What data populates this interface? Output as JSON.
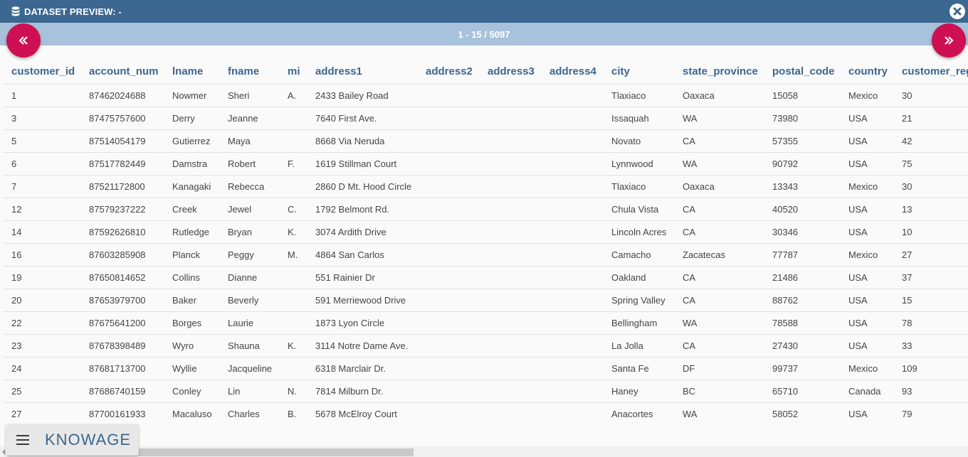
{
  "window": {
    "title": "DATASET PREVIEW: -",
    "icon": "database-icon",
    "close_icon": "close-circle-icon"
  },
  "pager": {
    "range": "1 - 15 / 5097",
    "prev_icon": "double-chevron-left-icon",
    "next_icon": "double-chevron-right-icon"
  },
  "table": {
    "columns": [
      "customer_id",
      "account_num",
      "lname",
      "fname",
      "mi",
      "address1",
      "address2",
      "address3",
      "address4",
      "city",
      "state_province",
      "postal_code",
      "country",
      "customer_region_id"
    ],
    "rows": [
      [
        "1",
        "87462024688",
        "Nowmer",
        "Sheri",
        "A.",
        "2433 Bailey Road",
        "",
        "",
        "",
        "Tlaxiaco",
        "Oaxaca",
        "15058",
        "Mexico",
        "30"
      ],
      [
        "3",
        "87475757600",
        "Derry",
        "Jeanne",
        "",
        "7640 First Ave.",
        "",
        "",
        "",
        "Issaquah",
        "WA",
        "73980",
        "USA",
        "21"
      ],
      [
        "5",
        "87514054179",
        "Gutierrez",
        "Maya",
        "",
        "8668 Via Neruda",
        "",
        "",
        "",
        "Novato",
        "CA",
        "57355",
        "USA",
        "42"
      ],
      [
        "6",
        "87517782449",
        "Damstra",
        "Robert",
        "F.",
        "1619 Stillman Court",
        "",
        "",
        "",
        "Lynnwood",
        "WA",
        "90792",
        "USA",
        "75"
      ],
      [
        "7",
        "87521172800",
        "Kanagaki",
        "Rebecca",
        "",
        "2860 D Mt. Hood Circle",
        "",
        "",
        "",
        "Tlaxiaco",
        "Oaxaca",
        "13343",
        "Mexico",
        "30"
      ],
      [
        "12",
        "87579237222",
        "Creek",
        "Jewel",
        "C.",
        "1792 Belmont Rd.",
        "",
        "",
        "",
        "Chula Vista",
        "CA",
        "40520",
        "USA",
        "13"
      ],
      [
        "14",
        "87592626810",
        "Rutledge",
        "Bryan",
        "K.",
        "3074 Ardith Drive",
        "",
        "",
        "",
        "Lincoln Acres",
        "CA",
        "30346",
        "USA",
        "10"
      ],
      [
        "16",
        "87603285908",
        "Planck",
        "Peggy",
        "M.",
        "4864 San Carlos",
        "",
        "",
        "",
        "Camacho",
        "Zacatecas",
        "77787",
        "Mexico",
        "27"
      ],
      [
        "19",
        "87650814652",
        "Collins",
        "Dianne",
        "",
        "551 Rainier Dr",
        "",
        "",
        "",
        "Oakland",
        "CA",
        "21486",
        "USA",
        "37"
      ],
      [
        "20",
        "87653979700",
        "Baker",
        "Beverly",
        "",
        "591 Merriewood Drive",
        "",
        "",
        "",
        "Spring Valley",
        "CA",
        "88762",
        "USA",
        "15"
      ],
      [
        "22",
        "87675641200",
        "Borges",
        "Laurie",
        "",
        "1873 Lyon Circle",
        "",
        "",
        "",
        "Bellingham",
        "WA",
        "78588",
        "USA",
        "78"
      ],
      [
        "23",
        "87678398489",
        "Wyro",
        "Shauna",
        "K.",
        "3114 Notre Dame Ave.",
        "",
        "",
        "",
        "La Jolla",
        "CA",
        "27430",
        "USA",
        "33"
      ],
      [
        "24",
        "87681713700",
        "Wyllie",
        "Jacqueline",
        "",
        "6318 Marclair Dr.",
        "",
        "",
        "",
        "Santa Fe",
        "DF",
        "99737",
        "Mexico",
        "109"
      ],
      [
        "25",
        "87686740159",
        "Conley",
        "Lin",
        "N.",
        "7814 Milburn Dr.",
        "",
        "",
        "",
        "Haney",
        "BC",
        "65710",
        "Canada",
        "93"
      ],
      [
        "27",
        "87700161933",
        "Macaluso",
        "Charles",
        "B.",
        "5678 McElroy Court",
        "",
        "",
        "",
        "Anacortes",
        "WA",
        "58052",
        "USA",
        "79"
      ]
    ]
  },
  "footer": {
    "brand": "KNOWAGE",
    "menu_icon": "hamburger-menu-icon"
  },
  "colors": {
    "title_bar": "#3c6790",
    "pager_bar": "#a8c2db",
    "nav_button": "#ce0f52",
    "header_text": "#3c6790"
  }
}
